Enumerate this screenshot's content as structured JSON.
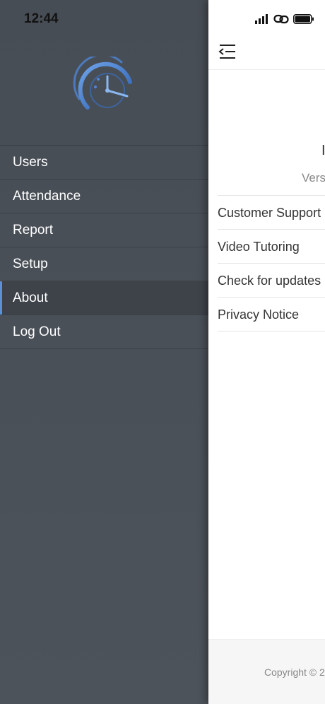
{
  "status_bar": {
    "time": "12:44",
    "icons": [
      "signal-icon",
      "link-icon",
      "battery-icon"
    ]
  },
  "drawer": {
    "logo": "clock-gauge-logo",
    "menu": [
      {
        "label": "Users",
        "active": false
      },
      {
        "label": "Attendance",
        "active": false
      },
      {
        "label": "Report",
        "active": false
      },
      {
        "label": "Setup",
        "active": false
      },
      {
        "label": "About",
        "active": true
      },
      {
        "label": "Log Out",
        "active": false
      }
    ]
  },
  "about": {
    "title_fragment": "I",
    "version_fragment": "Vers",
    "links": [
      "Customer Support",
      "Video Tutoring",
      "Check for updates",
      "Privacy Notice"
    ],
    "copyright_fragment": "Copyright © 2"
  },
  "colors": {
    "drawer_bg": "#4a5058",
    "active_item_bg": "#3e434a",
    "accent": "#5b8fd6",
    "panel_bg": "#ffffff"
  }
}
